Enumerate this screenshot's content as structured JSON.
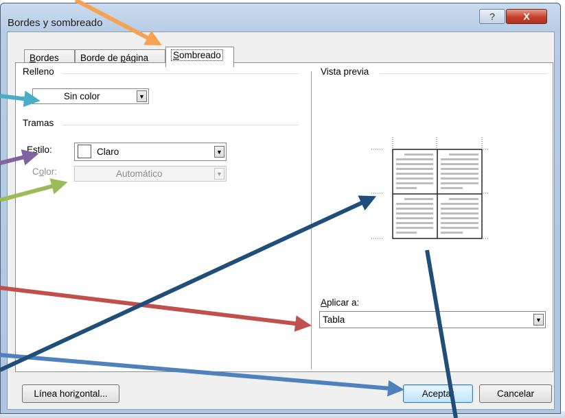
{
  "window": {
    "title": "Bordes y sombreado",
    "help_label": "?",
    "close_label": "X"
  },
  "tabs": [
    {
      "label_pre": "",
      "label_u": "B",
      "label_post": "ordes",
      "active": false
    },
    {
      "label_pre": "Borde de ",
      "label_u": "p",
      "label_post": "ágina",
      "active": false
    },
    {
      "label_pre": "",
      "label_u": "S",
      "label_post": "ombreado",
      "active": true
    }
  ],
  "relleno": {
    "label": "Relleno",
    "value": "Sin color"
  },
  "tramas": {
    "label": "Tramas",
    "estilo_label_u": "E",
    "estilo_label_post": "stilo:",
    "estilo_value": "Claro",
    "color_label_pre": "C",
    "color_label_u": "o",
    "color_label_post": "lor:",
    "color_value": "Automático"
  },
  "preview": {
    "label": "Vista previa"
  },
  "aplicar": {
    "label_u": "A",
    "label_post": "plicar a:",
    "value": "Tabla"
  },
  "buttons": {
    "horizontal_pre": "Línea hori",
    "horizontal_u": "z",
    "horizontal_post": "ontal...",
    "accept": "Aceptar",
    "cancel": "Cancelar"
  },
  "annotation_colors": {
    "orange": "#f7a152",
    "teal": "#4bacc6",
    "purple": "#8064a2",
    "green": "#9bbb59",
    "red": "#c0504d",
    "blue": "#4f81bd",
    "navy": "#1f4e79"
  }
}
